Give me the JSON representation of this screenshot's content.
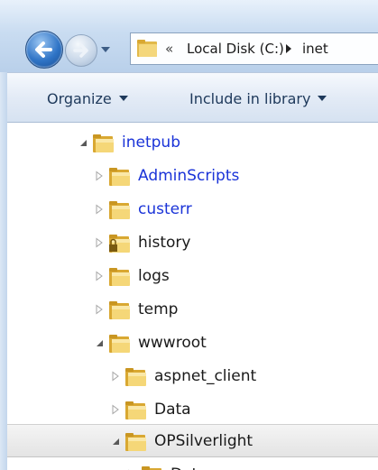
{
  "address_bar": {
    "overflow_chevron": "«",
    "crumbs": [
      "Local Disk (C:)",
      "inet"
    ]
  },
  "command_bar": {
    "organize_label": "Organize",
    "include_label": "Include in library"
  },
  "tree": {
    "items": [
      {
        "label": "inetpub",
        "expanded": true,
        "color": "blue",
        "lock": false
      },
      {
        "label": "AdminScripts",
        "expanded": false,
        "color": "blue",
        "lock": false
      },
      {
        "label": "custerr",
        "expanded": false,
        "color": "blue",
        "lock": false
      },
      {
        "label": "history",
        "expanded": false,
        "color": "black",
        "lock": true
      },
      {
        "label": "logs",
        "expanded": false,
        "color": "black",
        "lock": false
      },
      {
        "label": "temp",
        "expanded": false,
        "color": "black",
        "lock": false
      },
      {
        "label": "wwwroot",
        "expanded": true,
        "color": "black",
        "lock": false
      },
      {
        "label": "aspnet_client",
        "expanded": false,
        "color": "black",
        "lock": false
      },
      {
        "label": "Data",
        "expanded": false,
        "color": "black",
        "lock": false
      },
      {
        "label": "OPSilverlight",
        "expanded": true,
        "color": "black",
        "lock": false,
        "selected": true
      },
      {
        "label": "Data",
        "expanded": false,
        "color": "black",
        "lock": false
      }
    ]
  }
}
